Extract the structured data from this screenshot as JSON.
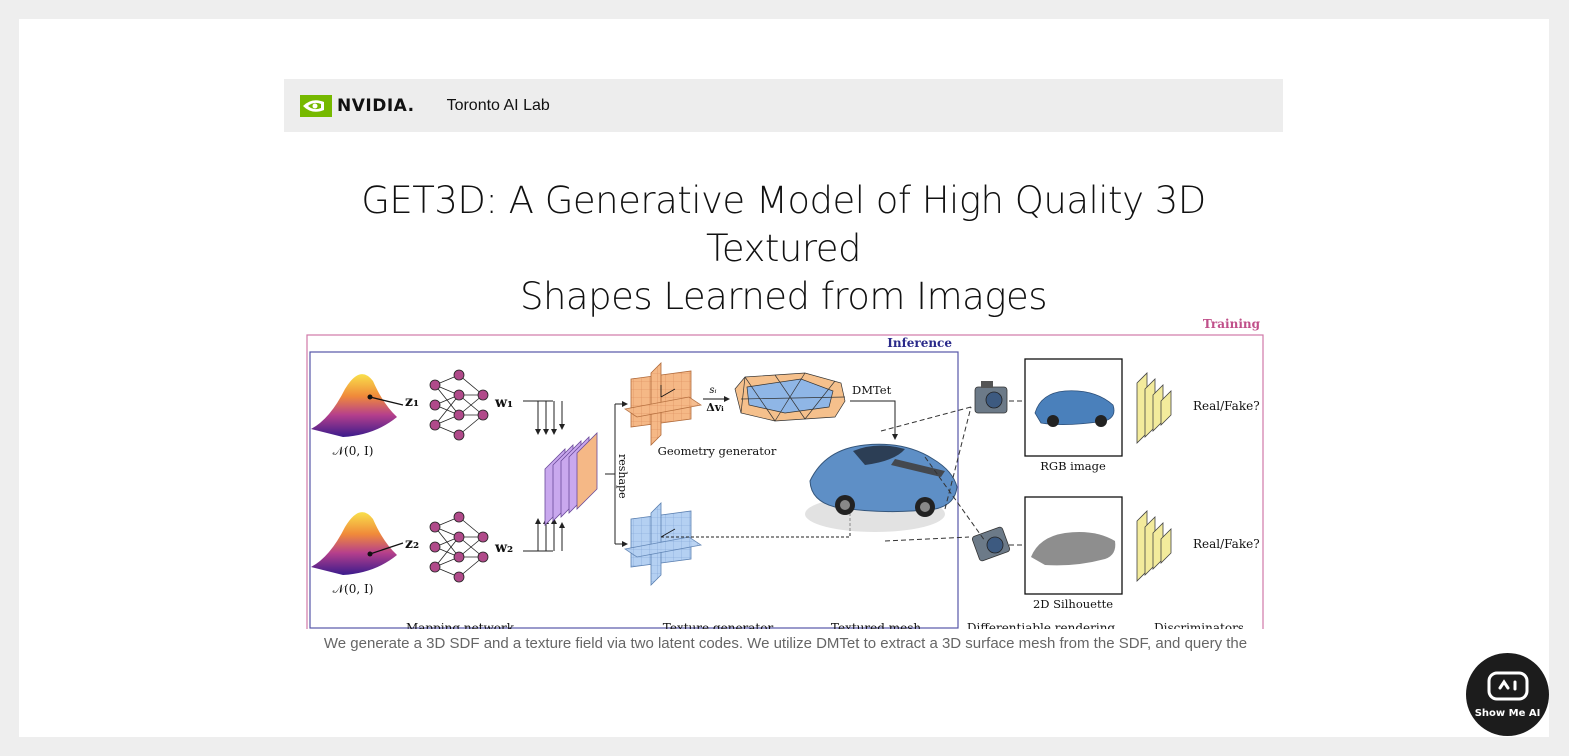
{
  "header": {
    "brand": "NVIDIA.",
    "lab": "Toronto AI Lab"
  },
  "paper": {
    "title_line1": "GET3D: A Generative Model of High Quality 3D Textured",
    "title_line2": "Shapes Learned from Images"
  },
  "figure": {
    "training_label": "Training",
    "inference_label": "Inference",
    "normal_dist_1": "𝒩(0, I)",
    "normal_dist_2": "𝒩(0, I)",
    "z1": "z₁",
    "z2": "z₂",
    "w1": "w₁",
    "w2": "w₂",
    "reshape": "reshape",
    "si": "sᵢ",
    "delta_v": "Δvᵢ",
    "dmtet": "DMTet",
    "geometry_generator": "Geometry generator",
    "texture_generator": "Texture generator",
    "mapping_network": "Mapping network",
    "textured_mesh": "Textured mesh",
    "differentiable_rendering": "Differentiable rendering",
    "discriminators": "Discriminators",
    "rgb_image": "RGB image",
    "silhouette": "2D Silhouette",
    "real_fake_1": "Real/Fake?",
    "real_fake_2": "Real/Fake?",
    "colors": {
      "training": "#c0508a",
      "inference": "#2a2a8a",
      "geometry": "#f2b27a",
      "texture": "#a9c8ee",
      "latent": "#b04a8a",
      "discriminator": "#f3eb9c"
    }
  },
  "caption": "We generate a 3D SDF and a texture field via two latent codes. We utilize DMTet to extract a 3D surface mesh from the SDF, and query the",
  "fab": {
    "label": "Show Me AI",
    "icon": "robot-icon"
  }
}
